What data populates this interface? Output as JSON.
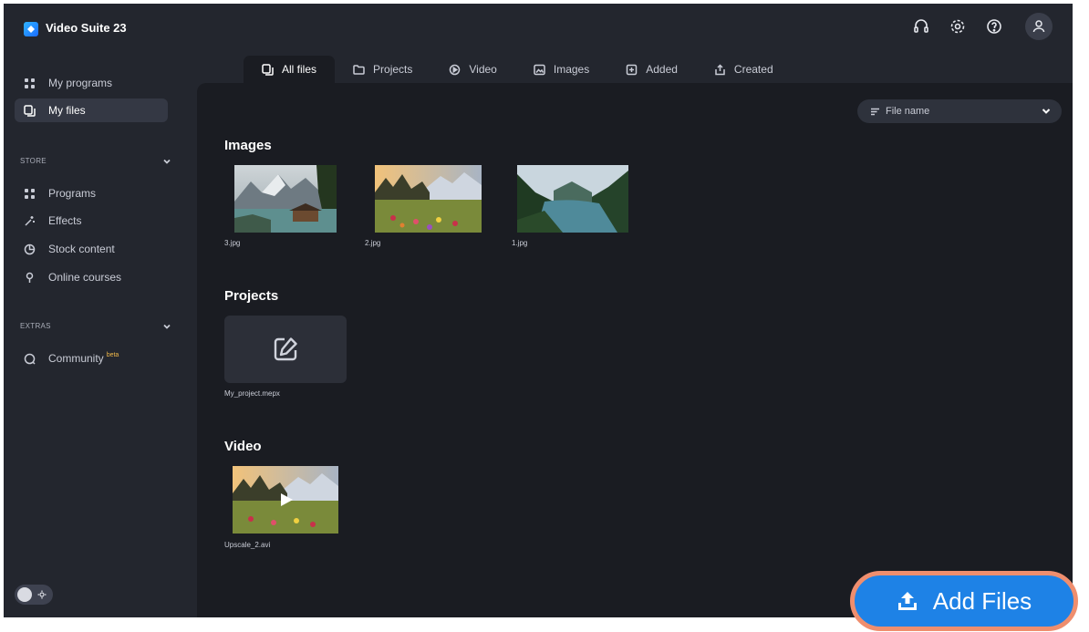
{
  "app": {
    "title": "Video Suite 23"
  },
  "sidebar": {
    "top_items": [
      {
        "label": "My programs",
        "icon": "grid-icon"
      },
      {
        "label": "My files",
        "icon": "files-icon"
      }
    ],
    "store": {
      "label": "STORE",
      "items": [
        {
          "label": "Programs",
          "icon": "grid-icon"
        },
        {
          "label": "Effects",
          "icon": "wand-icon"
        },
        {
          "label": "Stock content",
          "icon": "pie-icon"
        },
        {
          "label": "Online courses",
          "icon": "pin-icon"
        }
      ]
    },
    "extras": {
      "label": "EXTRAS",
      "items": [
        {
          "label": "Community",
          "badge": "beta",
          "icon": "chat-icon"
        }
      ]
    }
  },
  "tabs": [
    {
      "label": "All files",
      "icon": "files-icon"
    },
    {
      "label": "Projects",
      "icon": "folder-icon"
    },
    {
      "label": "Video",
      "icon": "play-circle-icon"
    },
    {
      "label": "Images",
      "icon": "image-icon"
    },
    {
      "label": "Added",
      "icon": "plus-box-icon"
    },
    {
      "label": "Created",
      "icon": "share-icon"
    }
  ],
  "sort": {
    "label": "File name"
  },
  "sections": {
    "images": {
      "title": "Images",
      "files": [
        "3.jpg",
        "2.jpg",
        "1.jpg"
      ]
    },
    "projects": {
      "title": "Projects",
      "files": [
        "My_project.mepx"
      ]
    },
    "video": {
      "title": "Video",
      "files": [
        "Upscale_2.avi"
      ]
    }
  },
  "add_files": {
    "label": "Add Files"
  },
  "colors": {
    "accent": "#1e82e6",
    "highlight": "#ef8e6e",
    "beta": "#f0b84a"
  }
}
